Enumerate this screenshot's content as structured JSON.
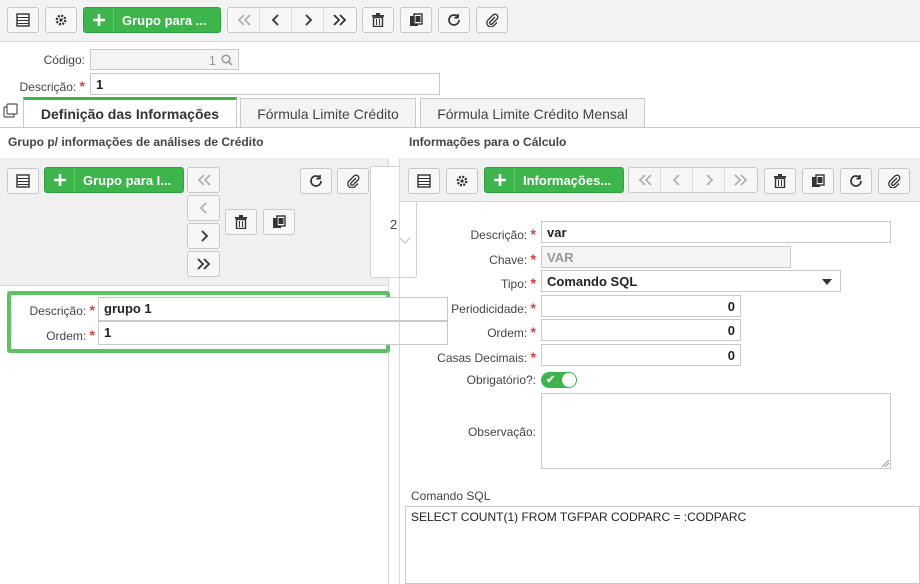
{
  "toolbar": {
    "add_label": "Grupo para ..."
  },
  "header": {
    "codigo_label": "Código:",
    "codigo_value": "1",
    "descricao_label": "Descrição:",
    "descricao_value": "1"
  },
  "tabs": [
    {
      "label": "Definição das Informações"
    },
    {
      "label": "Fórmula Limite Crédito"
    },
    {
      "label": "Fórmula Limite Crédito Mensal"
    }
  ],
  "left_panel": {
    "title": "Grupo p/ informações de análises de Crédito",
    "add_label": "Grupo para I...",
    "page_number": "2",
    "descricao_label": "Descrição:",
    "descricao_value": "grupo 1",
    "ordem_label": "Ordem:",
    "ordem_value": "1"
  },
  "right_panel": {
    "title": "Informações para o Cálculo",
    "add_label": "Informações...",
    "descricao_label": "Descrição:",
    "descricao_value": "var",
    "chave_label": "Chave:",
    "chave_value": "VAR",
    "tipo_label": "Tipo:",
    "tipo_value": "Comando SQL",
    "periodicidade_label": "Periodicidade:",
    "periodicidade_value": "0",
    "ordem_label": "Ordem:",
    "ordem_value": "0",
    "casas_label": "Casas Decimais:",
    "casas_value": "0",
    "obrigatorio_label": "Obrigatório?:",
    "observacao_label": "Observação:",
    "sql_label": "Comando SQL",
    "sql_value": "SELECT COUNT(1) FROM TGFPAR CODPARC  = :CODPARC"
  },
  "colors": {
    "accent": "#3cb54b",
    "highlight_border": "#5cc262",
    "required": "#e23b3b"
  }
}
